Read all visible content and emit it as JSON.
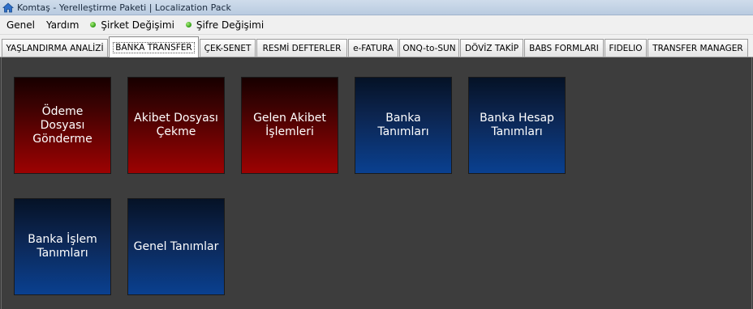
{
  "window": {
    "title": "Komtaş - Yerelleştirme Paketi | Localization Pack"
  },
  "menu": {
    "genel": "Genel",
    "yardim": "Yardım",
    "sirket": "Şirket Değişimi",
    "sifre": "Şifre Değişimi"
  },
  "tabs": [
    {
      "label": "YAŞLANDIRMA ANALİZİ"
    },
    {
      "label": "BANKA TRANSFER",
      "active": true
    },
    {
      "label": "ÇEK-SENET"
    },
    {
      "label": "RESMİ DEFTERLER"
    },
    {
      "label": "e-FATURA"
    },
    {
      "label": "ONQ-to-SUN"
    },
    {
      "label": "DÖVİZ TAKİP"
    },
    {
      "label": "BABS FORMLARI"
    },
    {
      "label": "FIDELIO"
    },
    {
      "label": "TRANSFER MANAGER"
    }
  ],
  "tiles": [
    {
      "label": "Ödeme Dosyası Gönderme",
      "color": "#9d0202"
    },
    {
      "label": "Akibet Dosyası Çekme",
      "color": "#9d0202"
    },
    {
      "label": "Gelen Akibet İşlemleri",
      "color": "#9d0202"
    },
    {
      "label": "Banka Tanımları",
      "color": "#0a4090"
    },
    {
      "label": "Banka Hesap Tanımları",
      "color": "#0a4090"
    },
    {
      "label": "Banka İşlem Tanımları",
      "color": "#0a4090"
    },
    {
      "label": "Genel Tanımlar",
      "color": "#0a4090"
    }
  ]
}
